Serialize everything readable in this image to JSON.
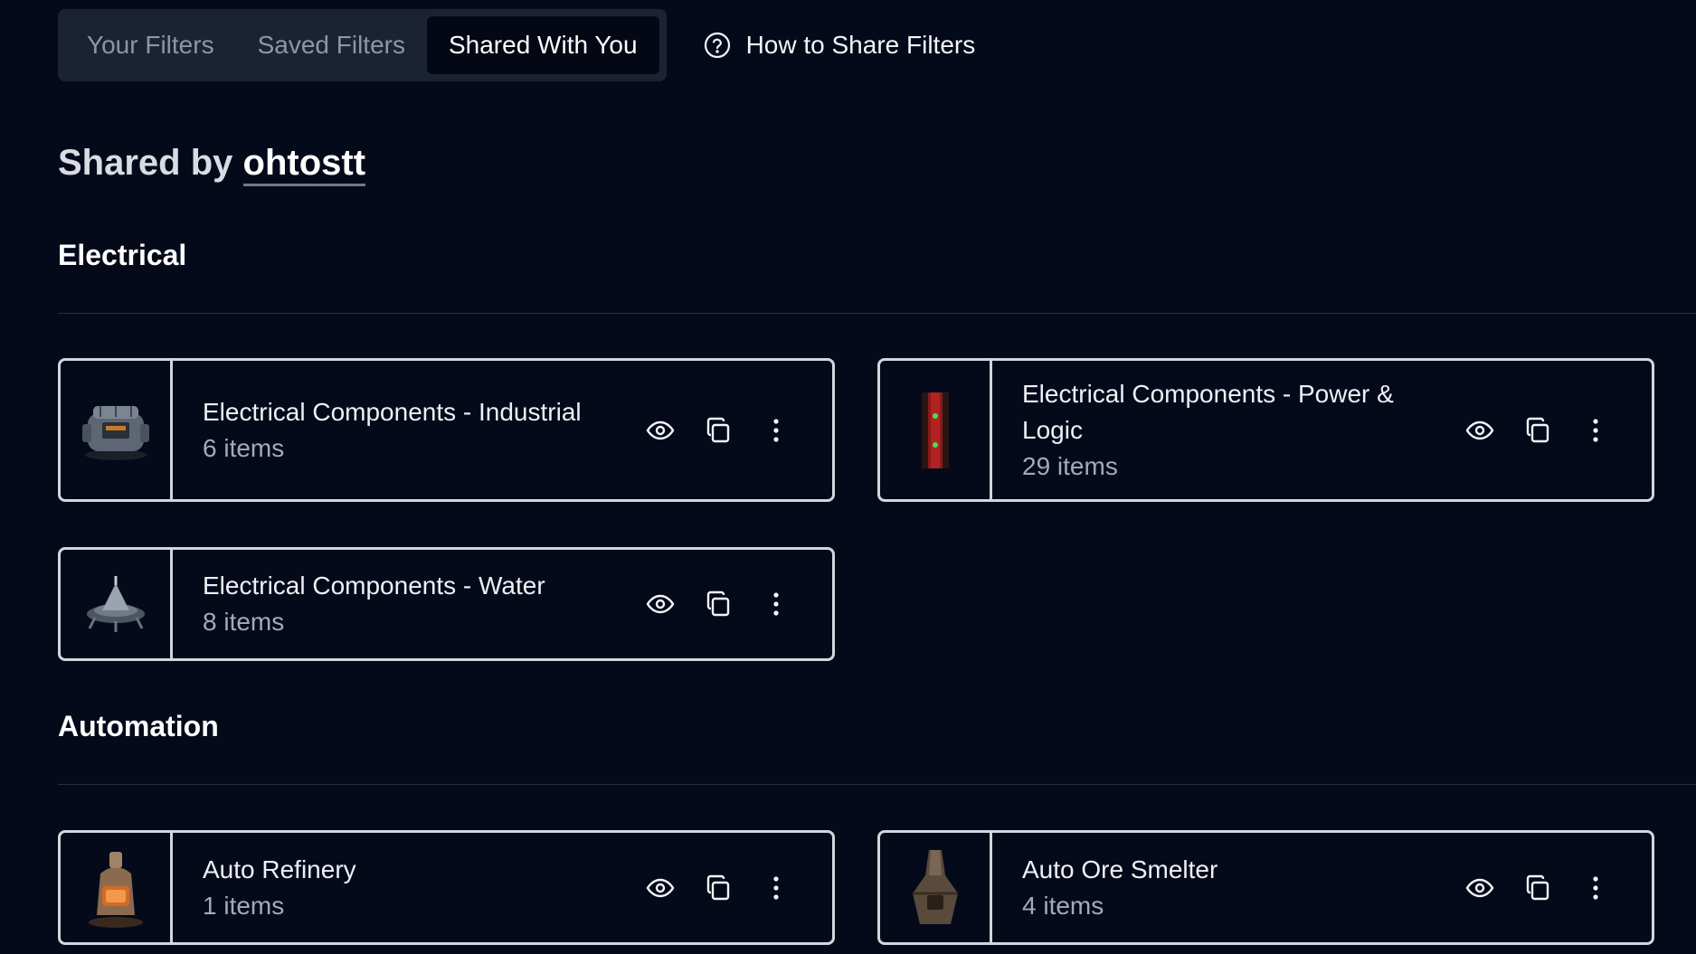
{
  "tabs": [
    {
      "label": "Your Filters",
      "active": false
    },
    {
      "label": "Saved Filters",
      "active": false
    },
    {
      "label": "Shared With You",
      "active": true
    }
  ],
  "howto": {
    "label": "How to Share Filters",
    "icon": "question-circle-icon"
  },
  "shared_by": {
    "prefix": "Shared by ",
    "user": "ohtostt"
  },
  "sections": [
    {
      "title": "Electrical",
      "cards": [
        {
          "title": "Electrical Components - Industrial",
          "count": "6 items",
          "thumb": "industrial-generator-icon"
        },
        {
          "title": "Electrical Components - Power & Logic",
          "count": "29 items",
          "thumb": "red-battery-icon"
        },
        {
          "title": "Electrical Components - Water",
          "count": "8 items",
          "thumb": "water-pump-icon"
        }
      ]
    },
    {
      "title": "Automation",
      "cards": [
        {
          "title": "Auto Refinery",
          "count": "1 items",
          "thumb": "refinery-icon"
        },
        {
          "title": "Auto Ore Smelter",
          "count": "4 items",
          "thumb": "smelter-icon"
        }
      ]
    }
  ],
  "card_actions": [
    "eye-icon",
    "copy-icon",
    "more-vertical-icon"
  ],
  "colors": {
    "background": "#050a1a",
    "tab_bar": "#1b2333",
    "card_border": "#d3d6dd",
    "muted_text": "#a3abb8"
  }
}
